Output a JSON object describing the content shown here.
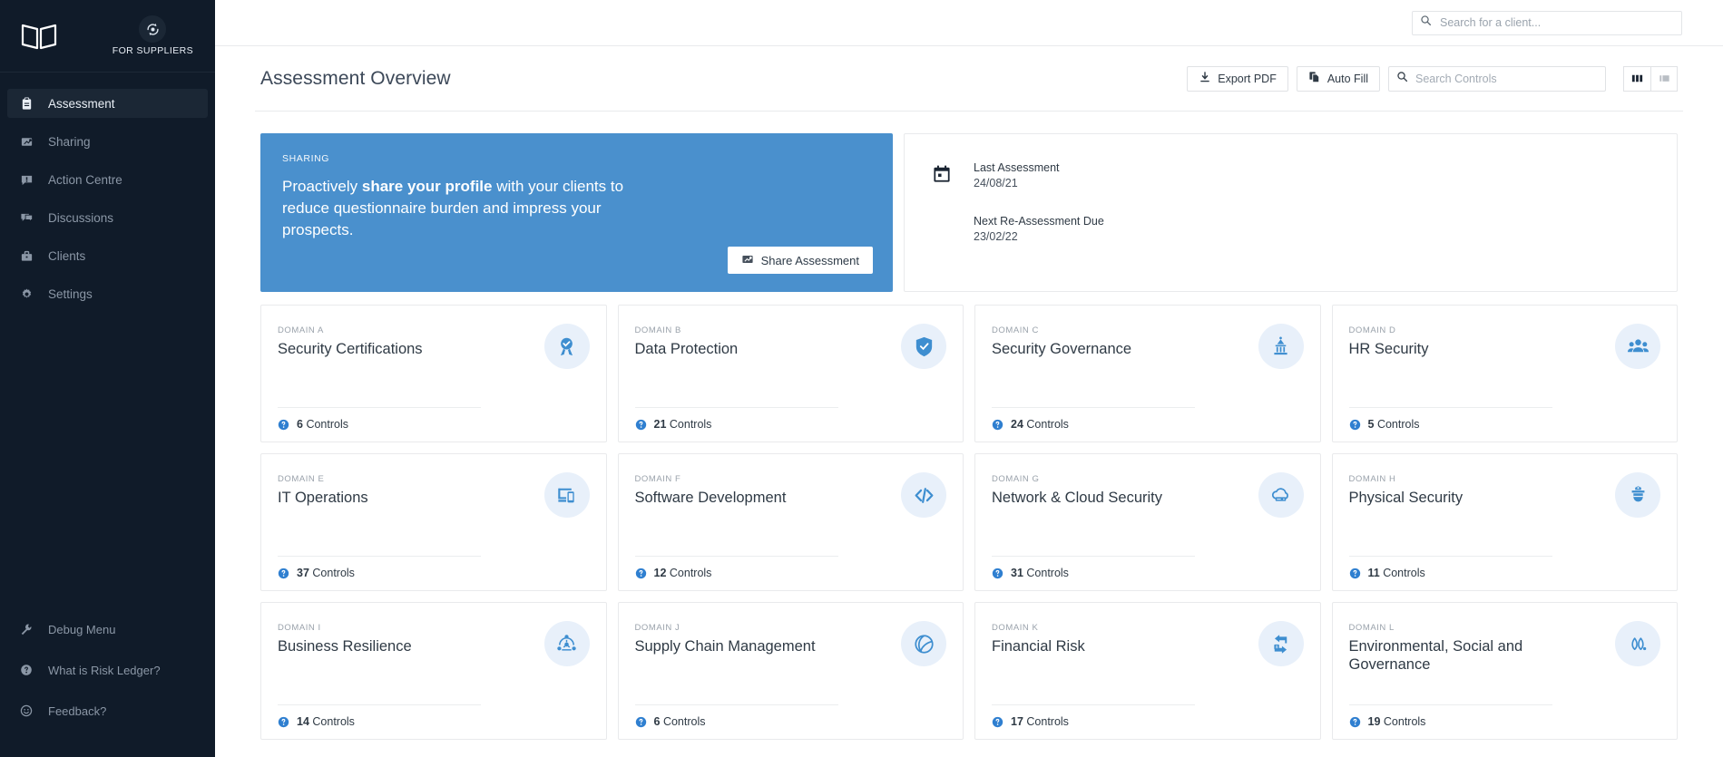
{
  "sidebar": {
    "logo_icon": "open-book-logo",
    "mode_icon": "switch-account-icon",
    "mode_label": "FOR SUPPLIERS",
    "items": [
      {
        "label": "Assessment",
        "icon": "clipboard-icon",
        "active": true
      },
      {
        "label": "Sharing",
        "icon": "share-icon",
        "active": false
      },
      {
        "label": "Action Centre",
        "icon": "alert-box-icon",
        "active": false
      },
      {
        "label": "Discussions",
        "icon": "chat-icon",
        "active": false
      },
      {
        "label": "Clients",
        "icon": "briefcase-icon",
        "active": false
      },
      {
        "label": "Settings",
        "icon": "gear-icon",
        "active": false
      }
    ],
    "bottom_items": [
      {
        "label": "Debug Menu",
        "icon": "wrench-icon"
      },
      {
        "label": "What is Risk Ledger?",
        "icon": "question-circle-icon"
      },
      {
        "label": "Feedback?",
        "icon": "smiley-icon"
      }
    ]
  },
  "topbar": {
    "client_search": {
      "value": "",
      "placeholder": "Search for a client...",
      "icon": "search-icon"
    }
  },
  "header": {
    "title": "Assessment Overview",
    "export_pdf_label": "Export PDF",
    "export_pdf_icon": "download-icon",
    "auto_fill_label": "Auto Fill",
    "auto_fill_icon": "copy-icon",
    "controls_search": {
      "value": "",
      "placeholder": "Search Controls",
      "icon": "search-icon"
    },
    "view_grid_icon": "grid-view-icon",
    "view_list_icon": "list-view-icon",
    "view_active": "grid"
  },
  "banner": {
    "kicker": "SHARING",
    "text_pre": "Proactively ",
    "text_bold": "share your profile",
    "text_post": " with your clients to reduce questionnaire burden and impress your prospects.",
    "button_label": "Share Assessment",
    "button_icon": "share-icon",
    "bg_color": "#4a90cd"
  },
  "info_card": {
    "icon": "calendar-icon",
    "last_label": "Last Assessment",
    "last_value": "24/08/21",
    "next_label": "Next Re-Assessment Due",
    "next_value": "23/02/22"
  },
  "controls_suffix": "Controls",
  "domains": [
    {
      "kicker": "DOMAIN A",
      "title": "Security Certifications",
      "controls": "6",
      "icon": "award-ribbon-icon"
    },
    {
      "kicker": "DOMAIN B",
      "title": "Data Protection",
      "controls": "21",
      "icon": "shield-check-icon"
    },
    {
      "kicker": "DOMAIN C",
      "title": "Security Governance",
      "controls": "24",
      "icon": "government-building-icon"
    },
    {
      "kicker": "DOMAIN D",
      "title": "HR Security",
      "controls": "5",
      "icon": "people-group-icon"
    },
    {
      "kicker": "DOMAIN E",
      "title": "IT Operations",
      "controls": "37",
      "icon": "devices-icon"
    },
    {
      "kicker": "DOMAIN F",
      "title": "Software Development",
      "controls": "12",
      "icon": "code-brackets-icon"
    },
    {
      "kicker": "DOMAIN G",
      "title": "Network & Cloud Security",
      "controls": "31",
      "icon": "cloud-server-icon"
    },
    {
      "kicker": "DOMAIN H",
      "title": "Physical Security",
      "controls": "11",
      "icon": "security-guard-icon"
    },
    {
      "kicker": "DOMAIN I",
      "title": "Business Resilience",
      "controls": "14",
      "icon": "resilience-network-icon"
    },
    {
      "kicker": "DOMAIN J",
      "title": "Supply Chain Management",
      "controls": "6",
      "icon": "globe-chain-icon"
    },
    {
      "kicker": "DOMAIN K",
      "title": "Financial Risk",
      "controls": "17",
      "icon": "money-transfer-icon"
    },
    {
      "kicker": "DOMAIN L",
      "title": "Environmental, Social and Governance",
      "controls": "19",
      "icon": "leaves-icon"
    }
  ],
  "colors": {
    "sidebar_bg": "#101b29",
    "accent_blue": "#3e7fc1",
    "banner_blue": "#4a90cd",
    "icon_bubble": "#e8f0fa"
  }
}
